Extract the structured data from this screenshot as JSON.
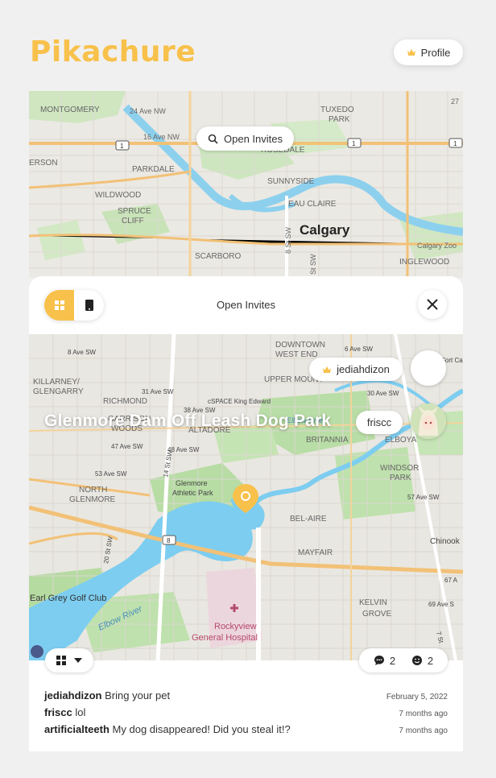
{
  "app": {
    "title": "Pikachure"
  },
  "header": {
    "profile_label": "Profile"
  },
  "top_map": {
    "search_pill_label": "Open Invites",
    "place_labels": [
      "MONTGOMERY",
      "24 Ave NW",
      "16 Ave NW",
      "TUXEDO",
      "PARK",
      "ROSEDALE",
      "SUNNYSIDE",
      "PARKDALE",
      "WILDWOOD",
      "SPRUCE",
      "CLIFF",
      "EAU CLAIRE",
      "Calgary",
      "SCARBORO",
      "INGLEWOOD",
      "Calgary Zoo",
      "ERSON",
      "8 St SW",
      "St SW",
      "27",
      "1"
    ]
  },
  "panel": {
    "title": "Open Invites",
    "event_title": "Glenmore Dam Off Leash Dog Park",
    "users": [
      {
        "name": "jediahdizon",
        "crown": true
      },
      {
        "name": "friscc",
        "crown": false
      }
    ],
    "comment_count": "2",
    "reaction_count": "2",
    "map_labels": [
      "Earl Grey Golf Club",
      "Rockyview",
      "General Hospital",
      "Glenmore",
      "Athletic Park",
      "BEL-AIRE",
      "MAYFAIR",
      "KELVIN",
      "GROVE",
      "BRITANNIA",
      "ELBOYA",
      "WINDSOR",
      "PARK",
      "NORTH",
      "GLENMORE",
      "GARRISON",
      "WOODS",
      "ALTADORE",
      "KILLARNEY/",
      "GLENGARRY",
      "RICHMOND",
      "UPPER MOUNT",
      "DOWNTOWN",
      "WEST END",
      "cSPACE King Edward",
      "Chinook",
      "Elbow River",
      "31 Ave SW",
      "38 Ave SW",
      "47 Ave SW",
      "48 Ave SW",
      "53 Ave SW",
      "57 Ave SW",
      "30 Ave SW",
      "69 Ave S",
      "67 A",
      "6 Ave SW",
      "Fort Ca",
      "Elbow River",
      "20 St SW",
      "14 St SW",
      "7 St",
      "8 Ave SW",
      "8"
    ]
  },
  "comments": [
    {
      "user": "jediahdizon",
      "text": "Bring your pet",
      "time": "February 5, 2022"
    },
    {
      "user": "friscc",
      "text": "lol",
      "time": "7 months ago"
    },
    {
      "user": "artificialteeth",
      "text": "My dog disappeared! Did you steal it!?",
      "time": "7 months ago"
    }
  ],
  "colors": {
    "accent": "#f8c14b",
    "water": "#7dcdf0",
    "park": "#b7dca4",
    "road": "#f2c177"
  },
  "icons": {
    "profile": "crown-icon",
    "search": "search-icon",
    "close": "close-icon",
    "grid": "grid-icon",
    "phone": "phone-icon",
    "comment": "comment-bubble-icon",
    "reaction": "smiley-icon",
    "pin": "map-pin-icon",
    "dropdown": "chevron-down-icon"
  }
}
